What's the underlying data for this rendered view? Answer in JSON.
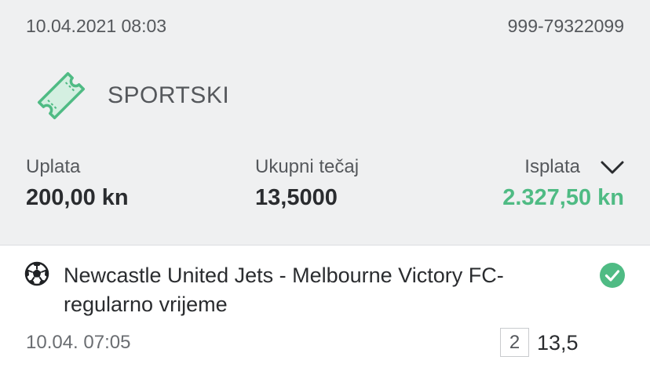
{
  "ticket": {
    "date": "10.04.2021 08:03",
    "id": "999-79322099",
    "type_label": "SPORTSKI",
    "type_icon": "ticket-icon",
    "accent_color": "#4fbb84"
  },
  "summary": {
    "stake_label": "Uplata",
    "stake_value": "200,00 kn",
    "odds_label": "Ukupni tečaj",
    "odds_value": "13,5000",
    "payout_label": "Isplata",
    "payout_value": "2.327,50 kn",
    "expand_icon": "chevron-down-icon"
  },
  "selections": [
    {
      "sport_icon": "soccer-ball-icon",
      "event": "Newcastle United Jets - Melbourne Victory FC- regularno vrijeme",
      "status_icon": "check-circle-icon",
      "status": "won",
      "time": "10.04. 07:05",
      "pick": "2",
      "odds": "13,5"
    }
  ]
}
